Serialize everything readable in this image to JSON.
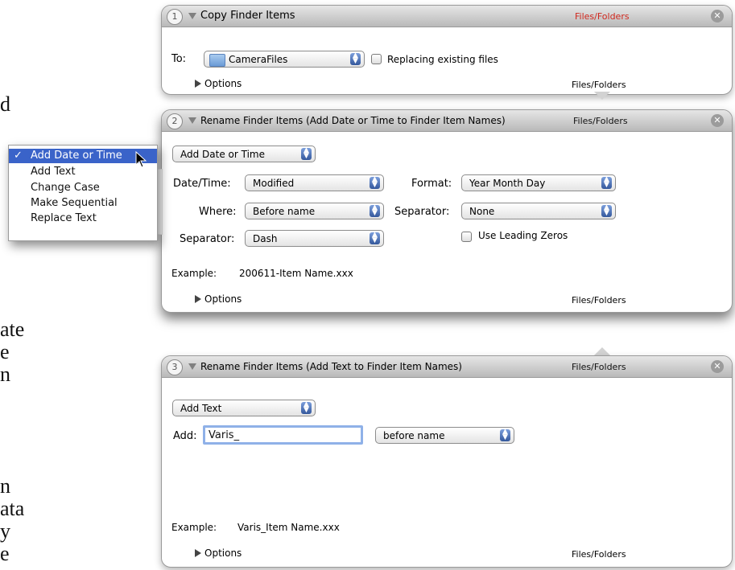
{
  "background_text": [
    "d",
    "ate",
    "e",
    "n",
    "n",
    "ata",
    "y",
    "e"
  ],
  "colors": {
    "files_folders_highlight": "#d0281e",
    "selected_menu": "#3a63c9"
  },
  "actions": [
    {
      "number": "1",
      "title": "Copy Finder Items",
      "type_label": "Files/Folders",
      "close_icon": "close-icon",
      "to_label": "To:",
      "folder_popup": "CameraFiles",
      "folder_icon": "folder-icon",
      "replacing_label": "Replacing existing files",
      "options_label": "Options",
      "footer_type": "Files/Folders"
    },
    {
      "number": "2",
      "title": "Rename Finder Items (Add Date or Time to Finder Item Names)",
      "type_label": "Files/Folders",
      "mode_popup": "Add Date or Time",
      "datetime_label": "Date/Time:",
      "datetime_popup": "Modified",
      "format_label": "Format:",
      "format_popup": "Year Month Day",
      "where_label": "Where:",
      "where_popup": "Before name",
      "separator_label": "Separator:",
      "separator_popup": "None",
      "separator2_label": "Separator:",
      "separator2_popup": "Dash",
      "leading_zeros_label": "Use Leading Zeros",
      "example_label": "Example:",
      "example_value": "200611-Item Name.xxx",
      "options_label": "Options",
      "footer_type": "Files/Folders"
    },
    {
      "number": "3",
      "title": "Rename Finder Items (Add Text to Finder Item Names)",
      "type_label": "Files/Folders",
      "mode_popup": "Add Text",
      "add_label": "Add:",
      "add_value": "Varis_",
      "position_popup": "before name",
      "example_label": "Example:",
      "example_value": "Varis_Item Name.xxx",
      "options_label": "Options",
      "footer_type": "Files/Folders"
    }
  ],
  "menu": {
    "items": [
      "Add Date or Time",
      "Add Text",
      "Change Case",
      "Make Sequential",
      "Replace Text"
    ],
    "selected": "Add Date or Time",
    "check_mark": "✓"
  }
}
